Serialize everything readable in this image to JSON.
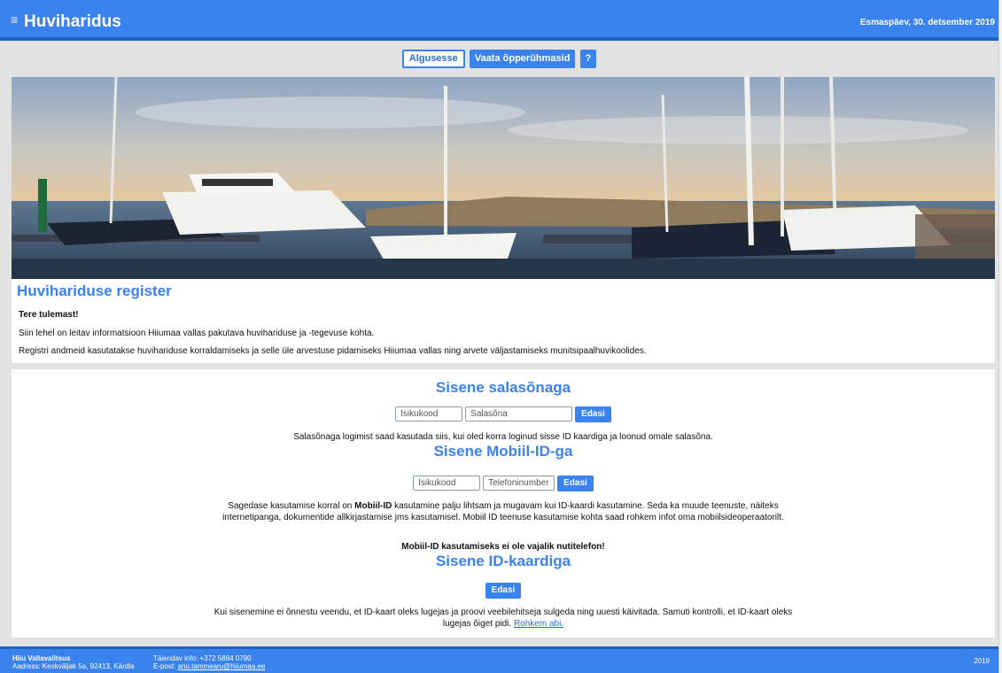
{
  "header": {
    "menu_glyph": "≡",
    "title": "Huviharidus",
    "date": "Esmaspäev, 30. detsember 2019"
  },
  "nav": {
    "home_label": "Algusesse",
    "groups_label": "Vaata õpperühmasid",
    "help_label": "?"
  },
  "intro": {
    "title": "Huvihariduse register",
    "welcome": "Tere tulemast!",
    "line1": "Siin lehel on leitav informatsioon Hiiumaa vallas pakutava huvihariduse ja -tegevuse kohta.",
    "line2": "Registri andmeid kasutatakse huvihariduse korraldamiseks ja selle üle arvestuse pidamiseks Hiiumaa vallas ning arvete väljastamiseks munitsipaalhuvikoolides."
  },
  "password_login": {
    "title": "Sisene salasõnaga",
    "id_placeholder": "Isikukood",
    "password_placeholder": "Salasõna",
    "submit_label": "Edasi",
    "note": "Salasõnaga logimist saad kasutada siis, kui oled korra loginud sisse ID kaardiga ja loonud omale salasõna."
  },
  "mobile_login": {
    "title": "Sisene Mobiil-ID-ga",
    "id_placeholder": "Isikukood",
    "phone_placeholder": "Telefoninumber",
    "submit_label": "Edasi",
    "note_pre": "Sagedase kasutamise korral on ",
    "note_bold": "Mobiil-ID",
    "note_post": " kasutamine palju lihtsam ja mugavam kui ID-kaardi kasutamine. Seda ka muude teenuste, näiteks internetipanga, dokumentide allkirjastamise jms kasutamisel. Mobiil ID teenuse kasutamise kohta saad rohkem infot oma mobiilsideoperaatorilt.",
    "warning": "Mobiil-ID kasutamiseks ei ole vajalik nutitelefon!"
  },
  "id_login": {
    "title": "Sisene ID-kaardiga",
    "submit_label": "Edasi",
    "note": "Kui sisenemine ei õnnestu veendu, et ID-kaart oleks lugejas ja proovi veebilehitseja sulgeda ning uuesti käivitada. Samuti kontrolli, et ID-kaart oleks lugejas õiget pidi. ",
    "more_help": "Rohkem abi."
  },
  "footer": {
    "org": "Hiiu Vallavalitsus",
    "address": "Aadress: Keskväljak 5a, 92413, Kärdla",
    "info": "Täiendav info: +372 5884 0790",
    "email_prefix": "E-post: ",
    "email": "anu.tammearu@hiiumaa.ee",
    "year": "2019"
  },
  "colors": {
    "accent": "#3a82ee",
    "accent_dark": "#1f5fc8"
  }
}
